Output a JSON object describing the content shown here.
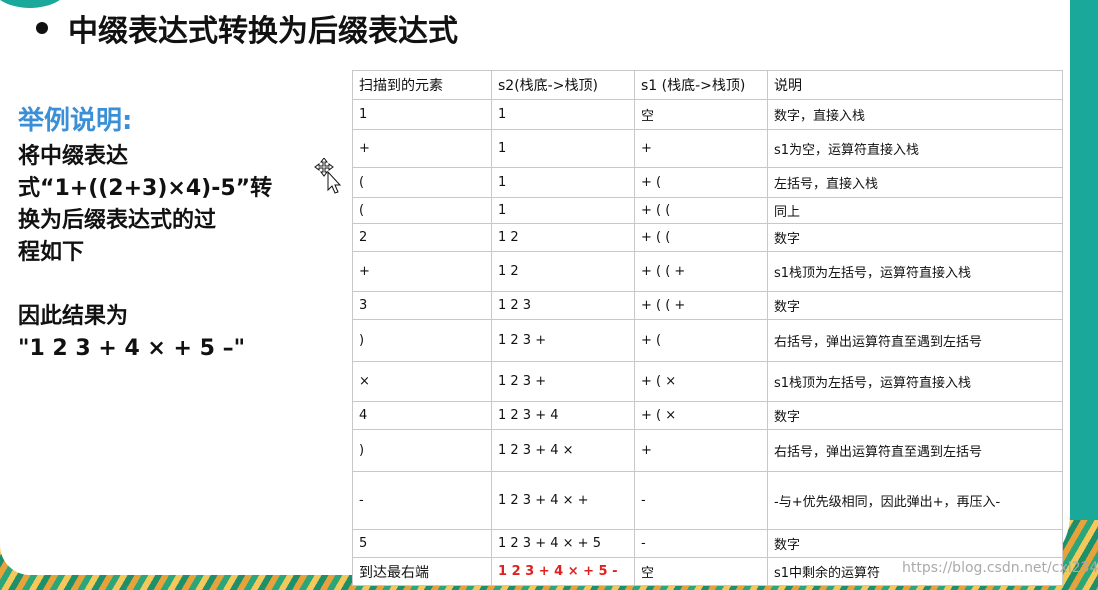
{
  "title": "中缀表达式转换为后缀表达式",
  "example_label": "举例说明:",
  "description": "将中缀表达\n式“1+((2+3)×4)-5”转\n换为后缀表达式的过\n程如下",
  "result": "因此结果为\n\"1 2 3 + 4 × + 5 –\"",
  "table": {
    "headers": [
      "扫描到的元素",
      "s2(栈底->栈顶)",
      "s1 (栈底->栈顶)",
      "说明"
    ],
    "rows": [
      {
        "elem": "1",
        "s2": "1",
        "s1": "空",
        "note": "数字，直接入栈",
        "h": 30
      },
      {
        "elem": "+",
        "s2": "1",
        "s1": "+",
        "note": "s1为空，运算符直接入栈",
        "h": 38
      },
      {
        "elem": "(",
        "s2": "1",
        "s1": "+ (",
        "note": "左括号，直接入栈",
        "h": 30
      },
      {
        "elem": "(",
        "s2": "1",
        "s1": "+ ( (",
        "note": "同上",
        "h": 26
      },
      {
        "elem": "2",
        "s2": "1 2",
        "s1": "+ ( (",
        "note": "数字",
        "h": 28
      },
      {
        "elem": "+",
        "s2": "1 2",
        "s1": "+ ( ( +",
        "note": "s1栈顶为左括号，运算符直接入栈",
        "h": 40
      },
      {
        "elem": "3",
        "s2": "1 2 3",
        "s1": "+ ( ( +",
        "note": "数字",
        "h": 28
      },
      {
        "elem": ")",
        "s2": "1 2 3 +",
        "s1": "+ (",
        "note": "右括号，弹出运算符直至遇到左括号",
        "h": 42
      },
      {
        "elem": "×",
        "s2": "1 2 3 +",
        "s1": "+ ( ×",
        "note": "s1栈顶为左括号，运算符直接入栈",
        "h": 40
      },
      {
        "elem": "4",
        "s2": "1 2 3 + 4",
        "s1": "+ ( ×",
        "note": "数字",
        "h": 28
      },
      {
        "elem": ")",
        "s2": "1 2 3 + 4 ×",
        "s1": "+",
        "note": "右括号，弹出运算符直至遇到左括号",
        "h": 42
      },
      {
        "elem": "-",
        "s2": "1 2 3 + 4 × +",
        "s1": "-",
        "note": "-与+优先级相同，因此弹出+，再压入-",
        "h": 58
      },
      {
        "elem": "5",
        "s2": "1 2 3 + 4 × + 5",
        "s1": "-",
        "note": "数字",
        "h": 28
      },
      {
        "elem": "到达最右端",
        "s2": "1 2 3 + 4 × + 5 -",
        "s1": "空",
        "note": "s1中剩余的运算符",
        "h": 28,
        "highlight": true
      }
    ]
  },
  "watermark": "https://blog.csdn.net/cxl234",
  "colors": {
    "accent_blue": "#3a8fd6",
    "highlight_red": "#e02020",
    "teal": "#1aa89a"
  }
}
